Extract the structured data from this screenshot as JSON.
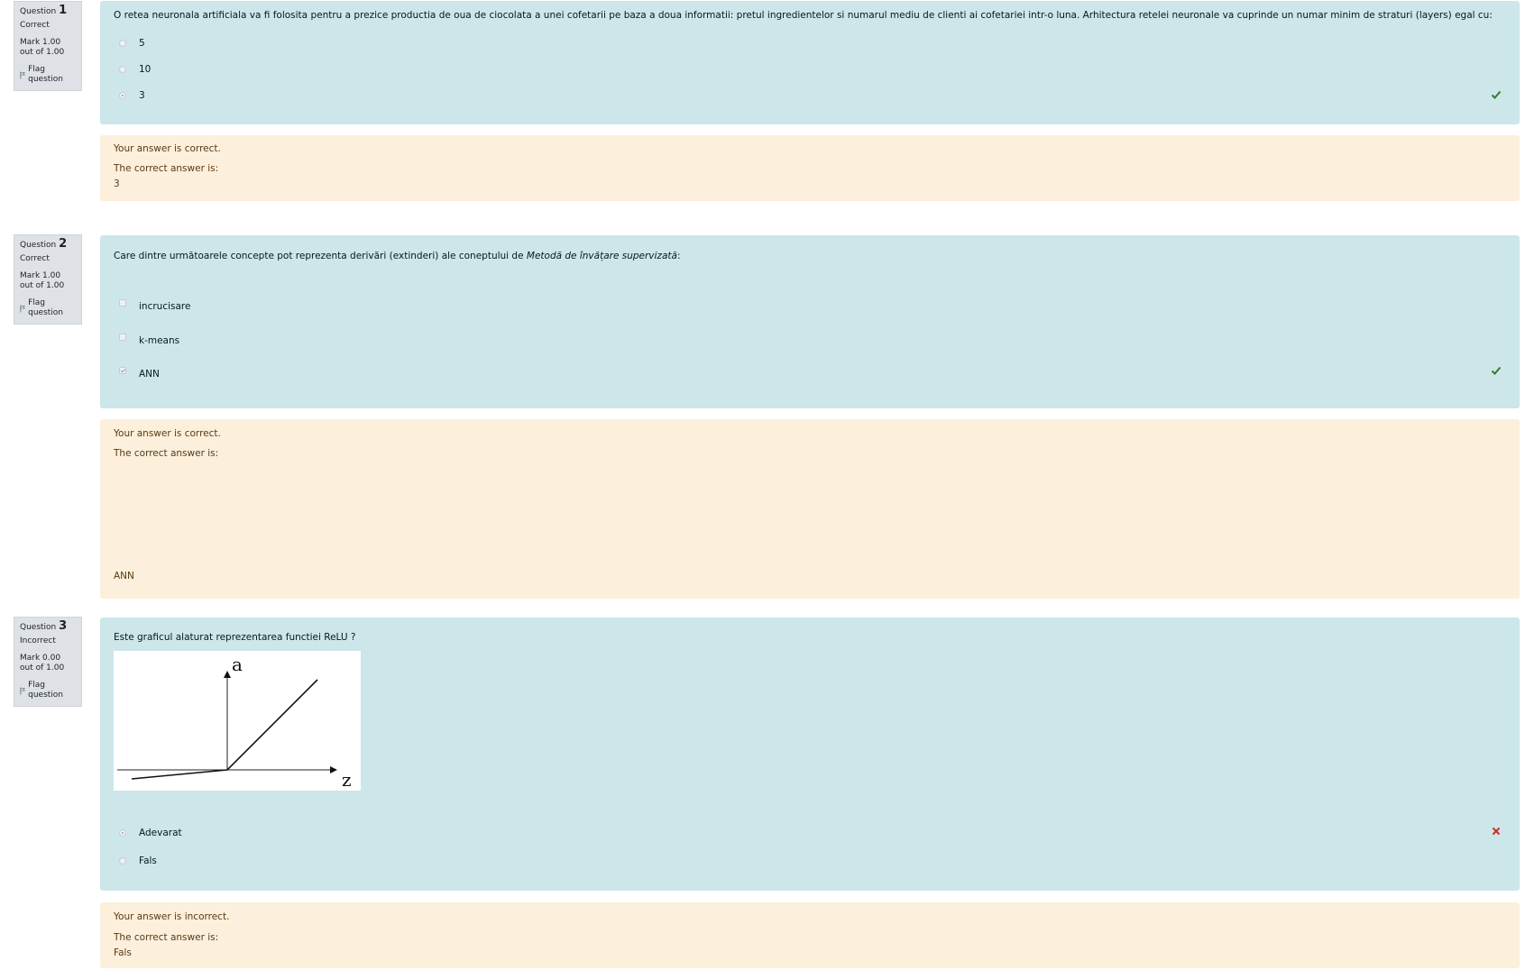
{
  "common": {
    "flag_label": "Flag question",
    "question_word": "Question"
  },
  "questions": [
    {
      "number": "1",
      "state": "Correct",
      "grade": "Mark 1.00 out of 1.00",
      "text": "O retea neuronala artificiala va fi folosita pentru a prezice productia de oua de ciocolata a unei cofetarii pe baza a doua informatii: pretul ingredientelor si numarul mediu de clienti ai cofetariei intr-o luna. Arhitectura retelei neuronale va cuprinde un numar minim de straturi (layers) egal cu:",
      "input_type": "radio",
      "options": [
        {
          "label": "5",
          "checked": false
        },
        {
          "label": "10",
          "checked": false
        },
        {
          "label": "3",
          "checked": true
        }
      ],
      "result_icon": "check-icon",
      "feedback": {
        "status": "Your answer is correct.",
        "correct_label": "The correct answer is:",
        "correct_answer": "3"
      }
    },
    {
      "number": "2",
      "state": "Correct",
      "grade": "Mark 1.00 out of 1.00",
      "text_prefix": "Care dintre următoarele concepte pot reprezenta derivări (extinderi) ale coneptului de ",
      "text_emph": "Metodă de învățare supervizată",
      "text_suffix": ":",
      "input_type": "checkbox",
      "options": [
        {
          "label": "incrucisare",
          "checked": false
        },
        {
          "label": "k-means",
          "checked": false
        },
        {
          "label": "ANN",
          "checked": true
        }
      ],
      "result_icon": "check-icon",
      "feedback": {
        "status": "Your answer is correct.",
        "correct_label": "The correct answer is:",
        "correct_answer": "ANN"
      }
    },
    {
      "number": "3",
      "state": "Incorrect",
      "grade": "Mark 0.00 out of 1.00",
      "text": "Este graficul alaturat reprezentarea functiei ReLU ?",
      "image": {
        "y_axis_label": "a",
        "x_axis_label": "z"
      },
      "input_type": "radio",
      "options": [
        {
          "label": "Adevarat",
          "checked": true
        },
        {
          "label": "Fals",
          "checked": false
        }
      ],
      "result_icon": "cross-icon",
      "feedback": {
        "status": "Your answer is incorrect.",
        "correct_label": "The correct answer is:",
        "correct_answer": "Fals"
      }
    }
  ],
  "colors": {
    "formulation_bg": "#cce6ea",
    "outcome_bg": "#fcefdc",
    "info_bg": "#dee2e6",
    "correct_green": "#357a32",
    "incorrect_red": "#ca3120"
  }
}
